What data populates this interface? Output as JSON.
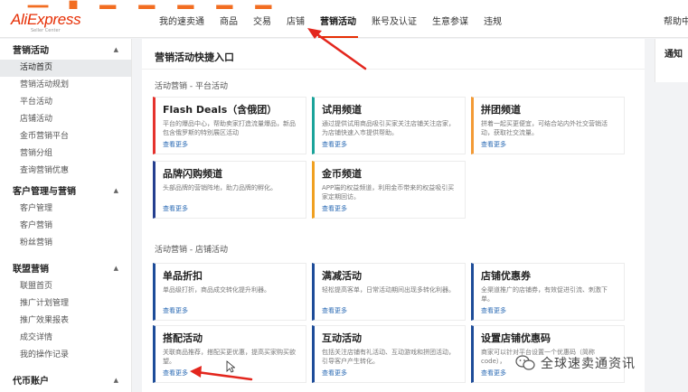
{
  "header": {
    "logo": "AliExpress",
    "logo_sub": "Seller Center",
    "nav": [
      "我的速卖通",
      "商品",
      "交易",
      "店铺",
      "营销活动",
      "账号及认证",
      "生意参谋",
      "违规"
    ],
    "active_nav": "营销活动",
    "help": "帮助中"
  },
  "sidebar": {
    "groups": [
      {
        "label": "营销活动",
        "items": [
          "活动首页",
          "营销活动规划",
          "平台活动",
          "店铺活动",
          "金币营销平台",
          "营销分组",
          "查询营销优惠"
        ]
      },
      {
        "label": "客户管理与营销",
        "items": [
          "客户管理",
          "客户营销",
          "粉丝营销"
        ]
      },
      {
        "label": "联盟营销",
        "items": [
          "联盟首页",
          "推广计划管理",
          "推广效果报表",
          "成交详情",
          "我的操作记录"
        ]
      },
      {
        "label": "代币账户",
        "items": []
      }
    ],
    "active_item": "活动首页"
  },
  "main": {
    "title": "营销活动快捷入口",
    "platform_section": "活动营销 - 平台活动",
    "store_section": "活动营销 - 店铺活动",
    "platform_cards": [
      {
        "title": "Flash Deals（含俄团）",
        "desc": "平台的爆品中心，帮助卖家打造流量爆品，新品包含俄罗斯的特别展区活动",
        "link": "查看更多",
        "color": "red"
      },
      {
        "title": "试用频道",
        "desc": "通过提供试用商品吸引买家关注店铺关注店家，为店铺快速入市提供帮助。",
        "link": "查看更多",
        "color": "teal"
      },
      {
        "title": "拼团频道",
        "desc": "拼着一起买更便宜，可结合站内外社交营销活动，获取社交流量。",
        "link": "查看更多",
        "color": "orange"
      },
      {
        "title": "品牌闪购频道",
        "desc": "头部品牌的营销阵地，助力品牌的孵化。",
        "link": "查看更多",
        "color": "navy"
      },
      {
        "title": "金币频道",
        "desc": "APP端的权益频道，利用金币带来的权益吸引买家定期回访。",
        "link": "查看更多",
        "color": "amber"
      }
    ],
    "store_cards": [
      {
        "title": "单品折扣",
        "desc": "单品级打折，商品成交转化提升利器。",
        "link": "查看更多",
        "color": "blue"
      },
      {
        "title": "满减活动",
        "desc": "轻松提高客单，日常活动期间出现多转化利器。",
        "link": "查看更多",
        "color": "blue"
      },
      {
        "title": "店铺优惠券",
        "desc": "全渠道推广的店铺券，有效促进引流、刺激下单。",
        "link": "查看更多",
        "color": "blue"
      },
      {
        "title": "搭配活动",
        "desc": "关联商品推荐，搭配买更优惠，提高买家购买欲望。",
        "link": "查看更多",
        "color": "blue"
      },
      {
        "title": "互动活动",
        "desc": "包括关注店铺有礼活动、互动游戏和拼团活动，引导客户产生转化。",
        "link": "查看更多",
        "color": "blue"
      },
      {
        "title": "设置店铺优惠码",
        "desc": "商家可以针对平台设置一个优惠码（简称code），",
        "link": "查看更多",
        "color": "blue"
      }
    ]
  },
  "notice": {
    "title": "通知"
  },
  "watermark": {
    "text": "全球速卖通资讯"
  }
}
